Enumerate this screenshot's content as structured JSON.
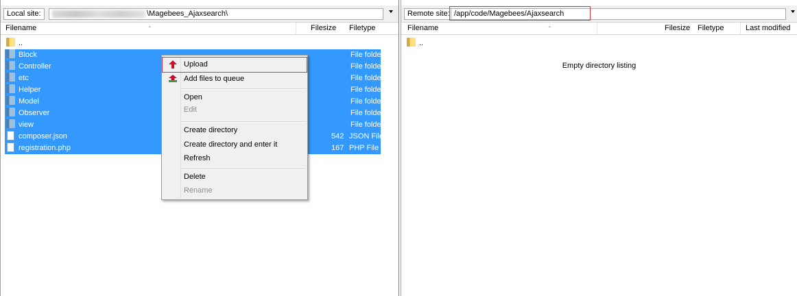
{
  "local": {
    "site_label": "Local site:",
    "path": "\\Magebees_Ajaxsearch\\",
    "columns": {
      "filename": "Filename",
      "filesize": "Filesize",
      "filetype": "Filetype"
    },
    "parent_entry": "..",
    "files": [
      {
        "name": "Block",
        "size": "",
        "type": "File folder",
        "icon": "folder-icon"
      },
      {
        "name": "Controller",
        "size": "",
        "type": "File folder",
        "icon": "folder-icon"
      },
      {
        "name": "etc",
        "size": "",
        "type": "File folder",
        "icon": "folder-icon"
      },
      {
        "name": "Helper",
        "size": "",
        "type": "File folder",
        "icon": "folder-icon"
      },
      {
        "name": "Model",
        "size": "",
        "type": "File folder",
        "icon": "folder-icon"
      },
      {
        "name": "Observer",
        "size": "",
        "type": "File folder",
        "icon": "folder-icon"
      },
      {
        "name": "view",
        "size": "",
        "type": "File folder",
        "icon": "folder-icon"
      },
      {
        "name": "composer.json",
        "size": "542",
        "type": "JSON File",
        "icon": "file-icon"
      },
      {
        "name": "registration.php",
        "size": "167",
        "type": "PHP File",
        "icon": "file-icon"
      }
    ]
  },
  "remote": {
    "site_label": "Remote site:",
    "path": "/app/code/Magebees/Ajaxsearch",
    "columns": {
      "filename": "Filename",
      "filesize": "Filesize",
      "filetype": "Filetype",
      "last_modified": "Last modified"
    },
    "parent_entry": "..",
    "empty_message": "Empty directory listing"
  },
  "context_menu": {
    "upload": "Upload",
    "add_to_queue": "Add files to queue",
    "open": "Open",
    "edit": "Edit",
    "create_directory": "Create directory",
    "create_directory_enter": "Create directory and enter it",
    "refresh": "Refresh",
    "delete": "Delete",
    "rename": "Rename"
  },
  "colors": {
    "selection": "#3399ff",
    "highlight_box": "#d9363e",
    "upload_arrow": "#c8102e"
  }
}
